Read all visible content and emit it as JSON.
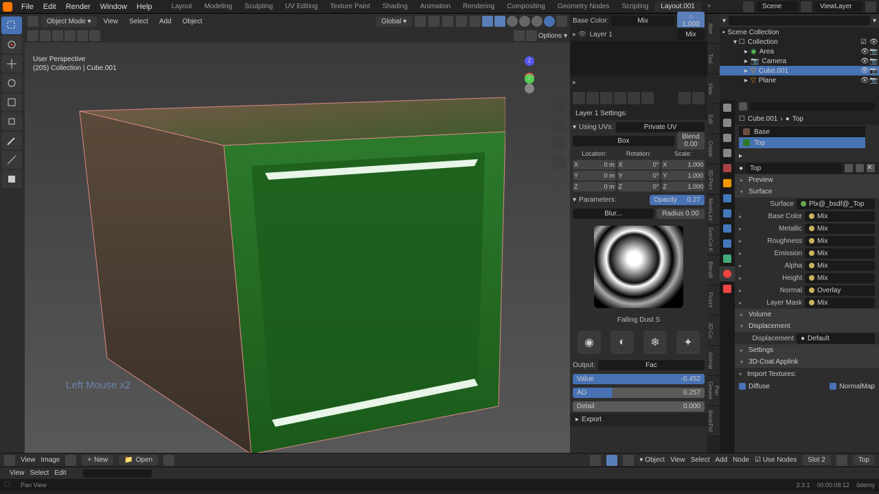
{
  "topmenu": [
    "File",
    "Edit",
    "Render",
    "Window",
    "Help"
  ],
  "workspaces": [
    "Layout",
    "Modeling",
    "Sculpting",
    "UV Editing",
    "Texture Paint",
    "Shading",
    "Animation",
    "Rendering",
    "Compositing",
    "Geometry Nodes",
    "Scripting"
  ],
  "active_workspace": "Layout.001",
  "scene": "Scene",
  "viewlayer": "ViewLayer",
  "viewport": {
    "mode": "Object Mode",
    "menu": [
      "View",
      "Select",
      "Add",
      "Object"
    ],
    "orientation": "Global",
    "overlay_line1": "User Perspective",
    "overlay_line2": "(205) Collection | Cube.001",
    "hint": "Left Mouse x2",
    "options_label": "Options"
  },
  "midpanel": {
    "basecolor_label": "Base Color:",
    "basecolor_mode": "Mix",
    "basecolor_value": "1.000",
    "layer_item": "Layer 1",
    "layer_mode": "Mix",
    "section_title": "Layer 1 Settings:",
    "uvs_label": "Using UVs:",
    "uvs_value": "Private UV",
    "proj_value": "Box",
    "blend_label": "Blend",
    "blend_value": "0.00",
    "loc_label": "Location:",
    "rot_label": "Rotation:",
    "scale_label": "Scale:",
    "xyz": {
      "loc": {
        "X": "0 m",
        "Y": "0 m",
        "Z": "0 m"
      },
      "rot": {
        "X": "0°",
        "Y": "0°",
        "Z": "0°"
      },
      "scale": {
        "X": "1.000",
        "Y": "1.000",
        "Z": "1.000"
      }
    },
    "params_label": "Parameters:",
    "opacity_label": "Opacity",
    "opacity_value": "0.27",
    "blur_label": "Blur...",
    "radius_label": "Radius",
    "radius_value": "0.00",
    "preview_name": "Falling  Dust S",
    "output_label": "Output:",
    "output_mode": "Fac",
    "sliders": [
      {
        "label": "Value",
        "value": "-0.452"
      },
      {
        "label": "AO",
        "value": "0.257"
      },
      {
        "label": "Detail",
        "value": "0.000"
      }
    ],
    "export_label": "Export"
  },
  "vtabs": [
    "Item",
    "Tool",
    "View",
    "Edit",
    "Create",
    "3D-Print",
    "MeshLint",
    "ScrnCst K",
    "Blendit",
    "Fluent",
    "3D-Co",
    "Animat",
    "Grease Pen",
    "MeshPol"
  ],
  "outliner": {
    "root": "Scene Collection",
    "coll": "Collection",
    "items": [
      "Area",
      "Camera",
      "Cube.001",
      "Plane"
    ],
    "selected": "Cube.001"
  },
  "materials": {
    "obj": "Cube.001",
    "slot": "Top",
    "list": [
      {
        "name": "Base",
        "color": "#6b5042"
      },
      {
        "name": "Top",
        "color": "#2d7a2d",
        "sel": true
      }
    ],
    "current": "Top"
  },
  "properties": {
    "preview_label": "Preview",
    "surface_label": "Surface",
    "surface_shader_label": "Surface",
    "surface_shader_value": "Plx@_bsdf@_Top",
    "channels": [
      {
        "label": "Base Color",
        "val": "Mix"
      },
      {
        "label": "Metallic",
        "val": "Mix"
      },
      {
        "label": "Roughness",
        "val": "Mix"
      },
      {
        "label": "Emission",
        "val": "Mix"
      },
      {
        "label": "Alpha",
        "val": "Mix"
      },
      {
        "label": "Height",
        "val": "Mix"
      },
      {
        "label": "Normal",
        "val": "Overlay"
      },
      {
        "label": "Layer Mask",
        "val": "Mix"
      }
    ],
    "volume_label": "Volume",
    "displacement_label": "Displacement",
    "disp_prop_label": "Displacement",
    "disp_prop_value": "Default",
    "settings_label": "Settings",
    "coat_label": "3D-Coat Applink",
    "import_tex_label": "Import Textures:",
    "chk_diffuse": "Diffuse",
    "chk_normal": "NormalMap"
  },
  "bottom1": {
    "menu": [
      "View",
      "Image"
    ],
    "new": "New",
    "open": "Open",
    "menu2": [
      "Object",
      "View",
      "Select",
      "Add",
      "Node"
    ],
    "use_nodes": "Use Nodes",
    "slot": "Slot 2",
    "mat": "Top"
  },
  "bottom2": {
    "menu": [
      "View",
      "Select",
      "Edit"
    ]
  },
  "status": {
    "pan": "Pan View",
    "version": "3.3.1",
    "time": "00:00:08:12"
  }
}
